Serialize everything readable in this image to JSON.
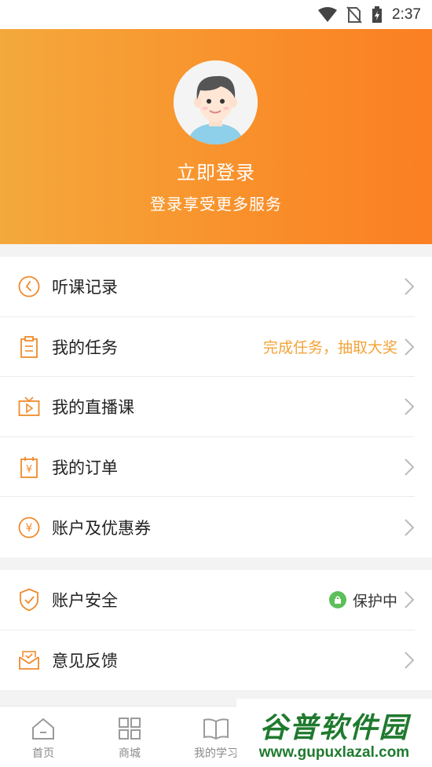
{
  "status_bar": {
    "time": "2:37"
  },
  "header": {
    "login_title": "立即登录",
    "login_subtitle": "登录享受更多服务"
  },
  "menu_group_1": [
    {
      "label": "听课记录",
      "icon": "clock-arrow-icon",
      "right_text": ""
    },
    {
      "label": "我的任务",
      "icon": "clipboard-icon",
      "right_text": "完成任务，抽取大奖"
    },
    {
      "label": "我的直播课",
      "icon": "tv-play-icon",
      "right_text": ""
    },
    {
      "label": "我的订单",
      "icon": "order-receipt-icon",
      "right_text": ""
    },
    {
      "label": "账户及优惠券",
      "icon": "yuan-circle-icon",
      "right_text": ""
    }
  ],
  "menu_group_2": [
    {
      "label": "账户安全",
      "icon": "shield-check-icon",
      "right_text": "保护中"
    },
    {
      "label": "意见反馈",
      "icon": "feedback-envelope-icon",
      "right_text": ""
    }
  ],
  "tabbar": [
    {
      "label": "首页",
      "icon": "home-icon"
    },
    {
      "label": "商城",
      "icon": "grid-icon"
    },
    {
      "label": "我的学习",
      "icon": "book-icon"
    }
  ],
  "watermark": {
    "main": "谷普软件园",
    "url": "www.gupuxlazal.com"
  },
  "colors": {
    "header_start": "#f4a93c",
    "header_end": "#fb7f23",
    "icon_orange": "#f08a2c",
    "hint_text": "#f3a43a",
    "secure_green": "#5cbf5a",
    "watermark_green": "#1f7a2e"
  }
}
